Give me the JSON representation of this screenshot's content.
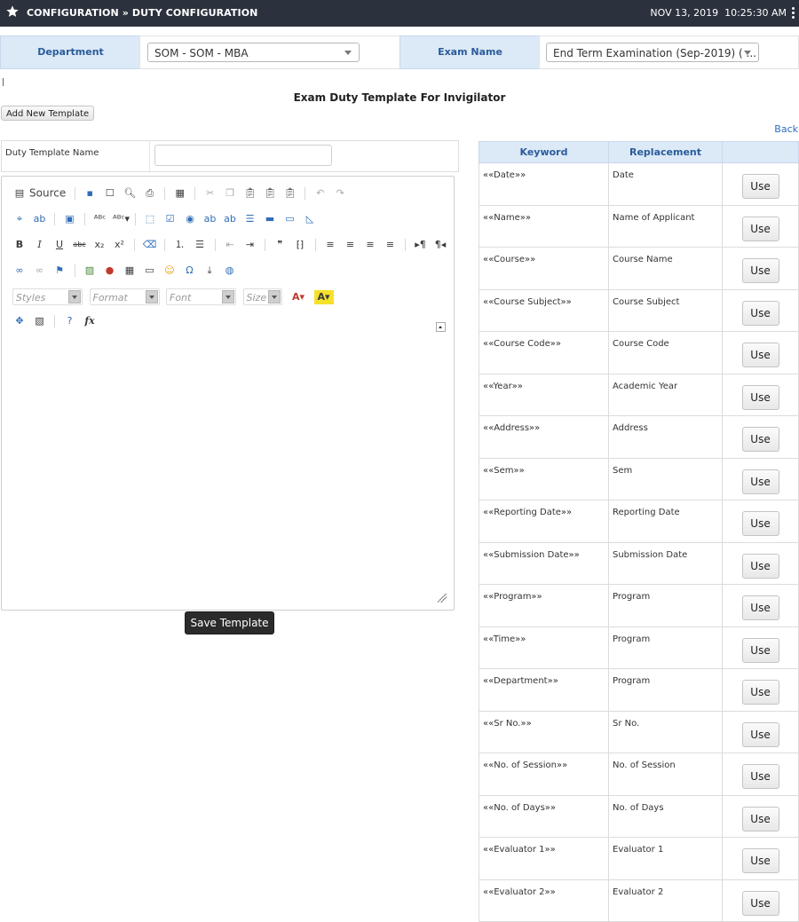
{
  "topbar": {
    "breadcrumb": "CONFIGURATION » DUTY CONFIGURATION",
    "date": "NOV 13, 2019",
    "time": "10:25:30 AM"
  },
  "filters": {
    "department_label": "Department",
    "department_value": "SOM - SOM - MBA",
    "exam_label": "Exam Name",
    "exam_value": "End Term Examination (Sep-2019) ( ..."
  },
  "page": {
    "title": "Exam Duty Template For Invigilator",
    "add_new_label": "Add New Template",
    "back_label": "Back"
  },
  "template_form": {
    "name_label": "Duty Template Name",
    "name_value": "",
    "save_label": "Save Template"
  },
  "editor": {
    "source_label": "Source",
    "styles_placeholder": "Styles",
    "format_placeholder": "Format",
    "font_placeholder": "Font",
    "size_placeholder": "Size"
  },
  "keywords": {
    "header_keyword": "Keyword",
    "header_replacement": "Replacement",
    "use_label": "Use",
    "rows": [
      {
        "keyword": "««Date»»",
        "replacement": "Date"
      },
      {
        "keyword": "««Name»»",
        "replacement": "Name of Applicant"
      },
      {
        "keyword": "««Course»»",
        "replacement": "Course Name"
      },
      {
        "keyword": "««Course Subject»»",
        "replacement": "Course Subject"
      },
      {
        "keyword": "««Course Code»»",
        "replacement": "Course Code"
      },
      {
        "keyword": "««Year»»",
        "replacement": "Academic Year"
      },
      {
        "keyword": "««Address»»",
        "replacement": "Address"
      },
      {
        "keyword": "««Sem»»",
        "replacement": "Sem"
      },
      {
        "keyword": "««Reporting Date»»",
        "replacement": "Reporting Date"
      },
      {
        "keyword": "««Submission Date»»",
        "replacement": "Submission Date"
      },
      {
        "keyword": "««Program»»",
        "replacement": "Program"
      },
      {
        "keyword": "««Time»»",
        "replacement": "Program"
      },
      {
        "keyword": "««Department»»",
        "replacement": "Program"
      },
      {
        "keyword": "««Sr No.»»",
        "replacement": "Sr No."
      },
      {
        "keyword": "««No. of Session»»",
        "replacement": "No. of Session"
      },
      {
        "keyword": "««No. of Days»»",
        "replacement": "No. of Days"
      },
      {
        "keyword": "««Evaluator 1»»",
        "replacement": "Evaluator 1"
      },
      {
        "keyword": "««Evaluator 2»»",
        "replacement": "Evaluator 2"
      }
    ]
  },
  "colors": {
    "topbar": "#2b313d",
    "header_bg": "#dce9f7",
    "header_text": "#2a5c9a",
    "link": "#2a6ebb",
    "save_button": "#2b2b2b"
  }
}
